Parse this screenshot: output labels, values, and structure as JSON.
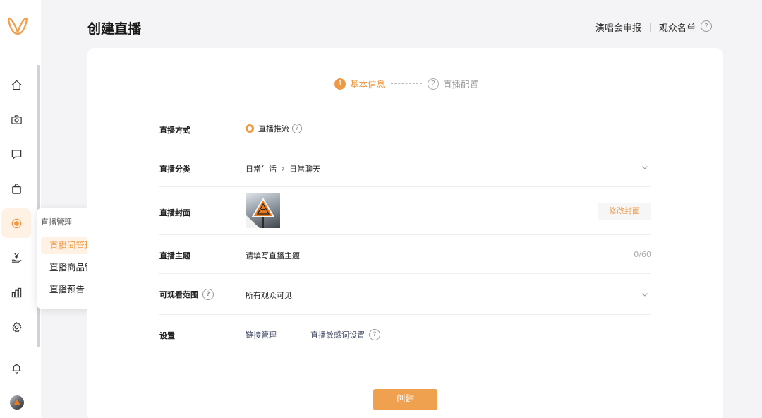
{
  "sidebar": {
    "nav": [
      {
        "icon": "home-icon"
      },
      {
        "icon": "camera-icon"
      },
      {
        "icon": "message-icon"
      },
      {
        "icon": "shopping-bag-icon"
      },
      {
        "icon": "live-icon",
        "active": true
      },
      {
        "icon": "yuan-hand-icon"
      },
      {
        "icon": "bar-chart-icon"
      },
      {
        "icon": "gear-icon"
      },
      {
        "icon": "bell-icon"
      }
    ]
  },
  "popup": {
    "title": "直播管理",
    "items": [
      "直播间管理",
      "直播商品管理",
      "直播预告"
    ]
  },
  "header": {
    "title": "创建直播",
    "links": [
      "演唱会申报",
      "观众名单"
    ]
  },
  "steps": [
    {
      "num": "1",
      "label": "基本信息"
    },
    {
      "num": "2",
      "label": "直播配置"
    }
  ],
  "form": {
    "method": {
      "label": "直播方式",
      "value": "直播推流"
    },
    "category": {
      "label": "直播分类",
      "path": [
        "日常生活",
        "日常聊天"
      ]
    },
    "cover": {
      "label": "直播封面",
      "button": "修改封面"
    },
    "topic": {
      "label": "直播主题",
      "placeholder": "请填写直播主题",
      "counter": "0/60"
    },
    "scope": {
      "label": "可观看范围",
      "placeholder": "所有观众可见"
    },
    "settings": {
      "label": "设置",
      "link1": "链接管理",
      "link2": "直播敏感词设置"
    }
  },
  "submit": "创建",
  "colors": {
    "accent": "#ee9a45",
    "button": "#f0a150"
  }
}
